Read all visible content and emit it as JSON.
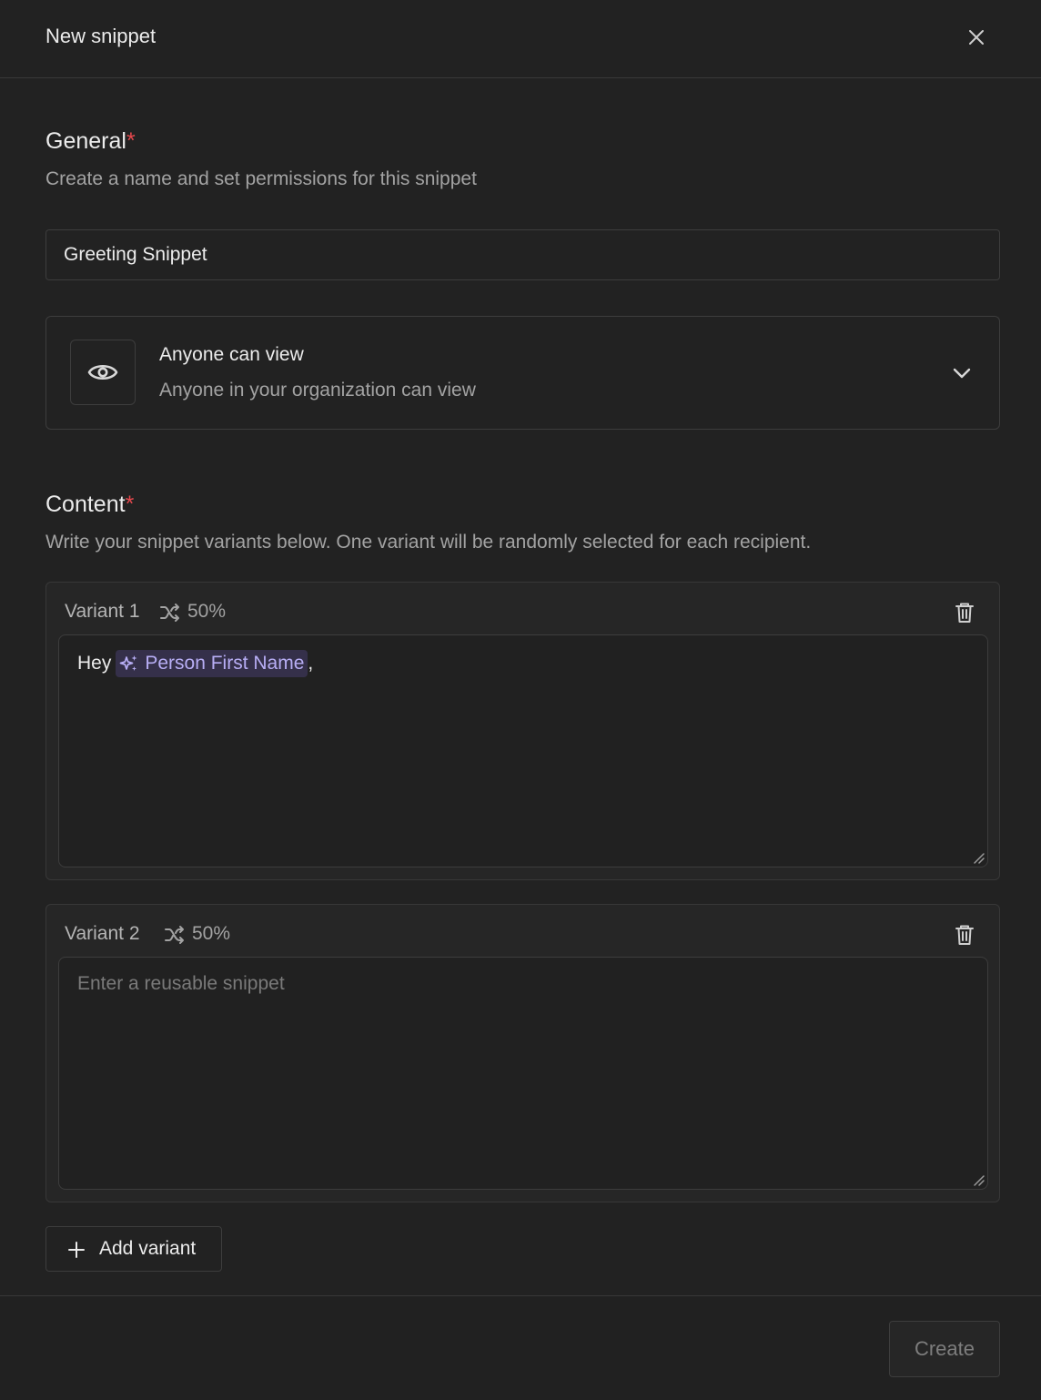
{
  "header": {
    "title": "New snippet"
  },
  "general": {
    "title": "General",
    "required_mark": "*",
    "description": "Create a name and set permissions for this snippet",
    "name_value": "Greeting Snippet",
    "permission": {
      "title": "Anyone can view",
      "description": "Anyone in your organization can view"
    }
  },
  "content": {
    "title": "Content",
    "required_mark": "*",
    "description": "Write your snippet variants below. One variant will be randomly selected for each recipient.",
    "variants": [
      {
        "label": "Variant 1",
        "weight": "50%",
        "text_before": "Hey",
        "variable": "Person First Name",
        "text_after": ","
      },
      {
        "label": "Variant 2",
        "weight": "50%",
        "placeholder": "Enter a reusable snippet"
      }
    ],
    "add_variant_label": "Add variant"
  },
  "footer": {
    "create_label": "Create"
  },
  "icons": {
    "close": "close-icon",
    "eye": "eye-icon",
    "chevron": "chevron-down-icon",
    "shuffle": "shuffle-icon",
    "trash": "trash-icon",
    "sparkle": "sparkle-icon",
    "plus": "plus-icon"
  },
  "colors": {
    "background": "#222222",
    "required": "#e5484d",
    "variable_chip_bg": "#35304a",
    "variable_chip_text": "#b8aef5"
  }
}
